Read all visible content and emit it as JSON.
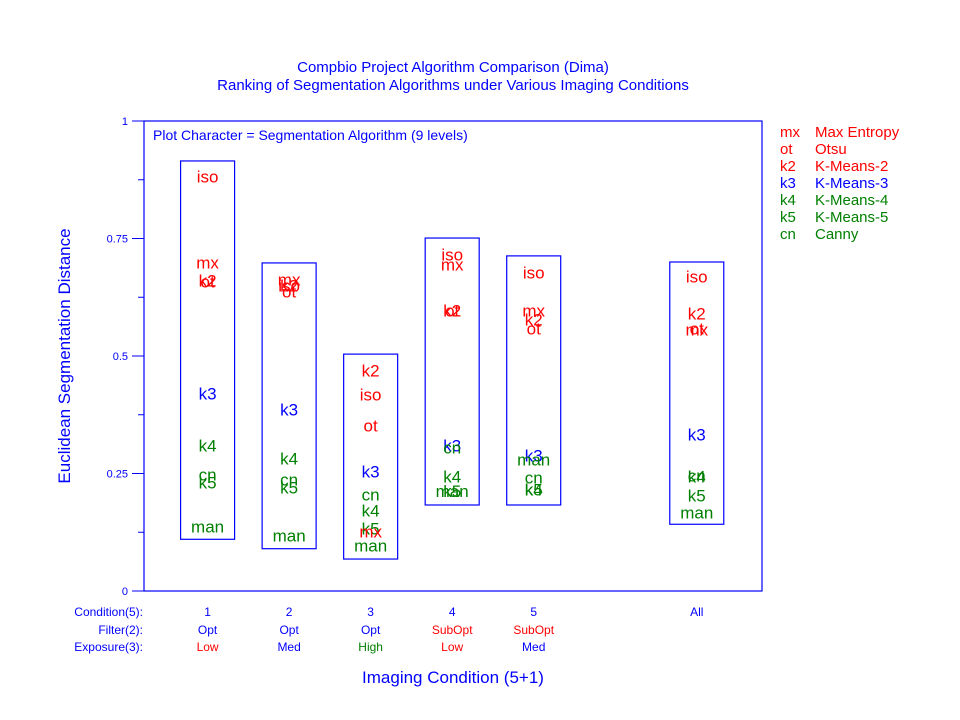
{
  "chart_data": {
    "type": "scatter",
    "title": "Compbio Project Algorithm Comparison (Dima)",
    "subtitle": "Ranking of Segmentation Algorithms under Various Imaging Conditions",
    "ylabel": "Euclidean Segmentation Distance",
    "xlabel": "Imaging Condition (5+1)",
    "annotation": "Plot Character = Segmentation Algorithm (9 levels)",
    "ylim": [
      0,
      1
    ],
    "xlim": [
      0.22,
      7.8
    ],
    "yticks": [
      {
        "value": 0,
        "label": "0"
      },
      {
        "value": 0.25,
        "label": "0.25"
      },
      {
        "value": 0.5,
        "label": "0.5"
      },
      {
        "value": 0.75,
        "label": "0.75"
      },
      {
        "value": 1,
        "label": "1"
      }
    ],
    "yminor_ticks": [
      0.125,
      0.375,
      0.625,
      0.875
    ],
    "grid": false,
    "legend_placement": "right",
    "colors": {
      "red": "#ff0000",
      "blue": "#0000ff",
      "green": "#008000"
    },
    "legend": [
      {
        "code": "mx",
        "name": "Max Entropy",
        "color": "#ff0000"
      },
      {
        "code": "ot",
        "name": "Otsu",
        "color": "#ff0000"
      },
      {
        "code": "k2",
        "name": "K-Means-2",
        "color": "#ff0000"
      },
      {
        "code": "k3",
        "name": "K-Means-3",
        "color": "#0000ff"
      },
      {
        "code": "k4",
        "name": "K-Means-4",
        "color": "#008000"
      },
      {
        "code": "k5",
        "name": "K-Means-5",
        "color": "#008000"
      },
      {
        "code": "cn",
        "name": "Canny",
        "color": "#008000"
      }
    ],
    "point_colors": {
      "iso": "#ff0000",
      "mx": "#ff0000",
      "ot": "#ff0000",
      "k2": "#ff0000",
      "k3": "#0000ff",
      "k4": "#008000",
      "k5": "#008000",
      "cn": "#008000",
      "man": "#008000"
    },
    "row_labels": [
      "Condition(5):",
      "Filter(2):",
      "Exposure(3):"
    ],
    "groups": [
      {
        "x": 1,
        "condition": "1",
        "filter": "Opt",
        "filter_color": "#0000ff",
        "exposure": "Low",
        "exposure_color": "#ff0000",
        "box": [
          0.11,
          0.915
        ],
        "points": {
          "iso": 0.879,
          "mx": 0.696,
          "k2": 0.657,
          "ot": 0.655,
          "k3": 0.417,
          "k4": 0.306,
          "cn": 0.245,
          "k5": 0.228,
          "man": 0.134
        }
      },
      {
        "x": 2,
        "condition": "2",
        "filter": "Opt",
        "filter_color": "#0000ff",
        "exposure": "Med",
        "exposure_color": "#0000ff",
        "box": [
          0.09,
          0.698
        ],
        "points": {
          "mx": 0.66,
          "iso": 0.647,
          "k2": 0.647,
          "ot": 0.634,
          "k3": 0.383,
          "k4": 0.279,
          "cn": 0.234,
          "k5": 0.217,
          "man": 0.115
        }
      },
      {
        "x": 3,
        "condition": "3",
        "filter": "Opt",
        "filter_color": "#0000ff",
        "exposure": "High",
        "exposure_color": "#008000",
        "box": [
          0.068,
          0.504
        ],
        "points": {
          "k2": 0.466,
          "iso": 0.415,
          "ot": 0.349,
          "k3": 0.251,
          "cn": 0.202,
          "k4": 0.168,
          "k5": 0.13,
          "mx": 0.123,
          "man": 0.094
        }
      },
      {
        "x": 4,
        "condition": "4",
        "filter": "SubOpt",
        "filter_color": "#ff0000",
        "exposure": "Low",
        "exposure_color": "#ff0000",
        "box": [
          0.183,
          0.751
        ],
        "points": {
          "iso": 0.713,
          "mx": 0.691,
          "k2": 0.594,
          "ot": 0.594,
          "k3": 0.306,
          "cn": 0.302,
          "k4": 0.24,
          "k5": 0.21,
          "man": 0.21
        }
      },
      {
        "x": 5,
        "condition": "5",
        "filter": "SubOpt",
        "filter_color": "#ff0000",
        "exposure": "Med",
        "exposure_color": "#0000ff",
        "box": [
          0.183,
          0.713
        ],
        "points": {
          "iso": 0.674,
          "mx": 0.594,
          "k2": 0.574,
          "ot": 0.555,
          "k3": 0.285,
          "man": 0.277,
          "cn": 0.238,
          "k4": 0.213,
          "k5": 0.213
        }
      },
      {
        "x": 7,
        "condition": "All",
        "filter": "",
        "filter_color": "#0000ff",
        "exposure": "",
        "exposure_color": "#0000ff",
        "box": [
          0.142,
          0.7
        ],
        "points": {
          "iso": 0.666,
          "k2": 0.587,
          "ot": 0.555,
          "mx": 0.553,
          "k3": 0.33,
          "cn": 0.243,
          "k4": 0.24,
          "k5": 0.2,
          "man": 0.164
        }
      }
    ]
  }
}
